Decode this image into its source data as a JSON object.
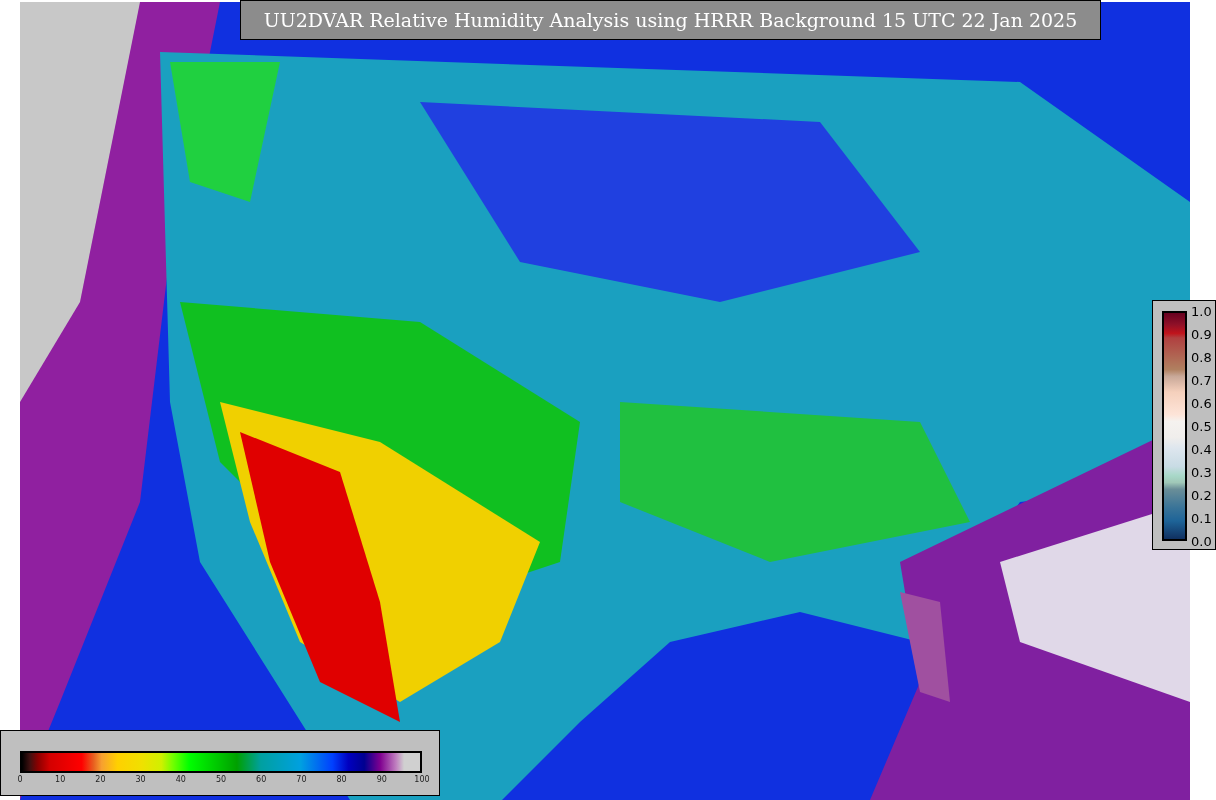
{
  "title": "UU2DVAR Relative Humidity Analysis using HRRR Background 15 UTC 22 Jan 2025",
  "bottom_colorbar": {
    "ticks": [
      "0",
      "10",
      "20",
      "30",
      "40",
      "50",
      "60",
      "70",
      "80",
      "90",
      "100"
    ]
  },
  "right_colorbar": {
    "ticks": [
      "1.0",
      "0.9",
      "0.8",
      "0.7",
      "0.6",
      "0.5",
      "0.4",
      "0.3",
      "0.2",
      "0.1",
      "0.0"
    ]
  }
}
